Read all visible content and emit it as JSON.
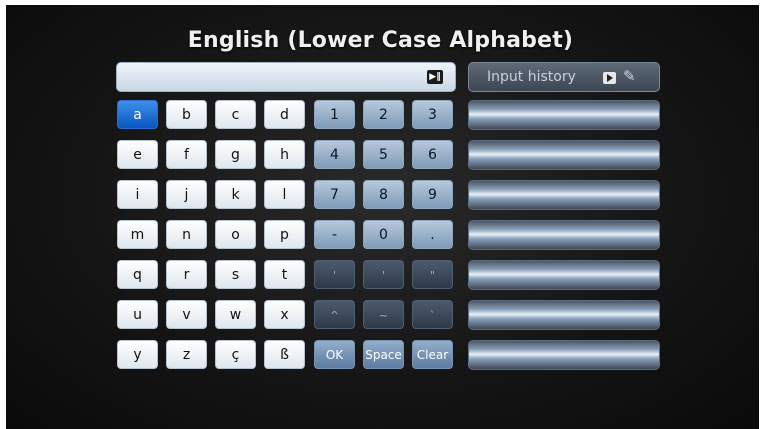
{
  "title": "English (Lower Case Alphabet)",
  "input": {
    "value": ""
  },
  "history": {
    "label": "Input history",
    "rows": [
      "",
      "",
      "",
      "",
      "",
      "",
      ""
    ]
  },
  "keys": {
    "row1": [
      "a",
      "b",
      "c",
      "d",
      "1",
      "2",
      "3"
    ],
    "row2": [
      "e",
      "f",
      "g",
      "h",
      "4",
      "5",
      "6"
    ],
    "row3": [
      "i",
      "j",
      "k",
      "l",
      "7",
      "8",
      "9"
    ],
    "row4": [
      "m",
      "n",
      "o",
      "p",
      "-",
      "0",
      "."
    ],
    "row5": [
      "q",
      "r",
      "s",
      "t",
      "'",
      "'",
      "\""
    ],
    "row6": [
      "u",
      "v",
      "w",
      "x",
      "^",
      "~",
      "`"
    ],
    "row7": [
      "y",
      "z",
      "ç",
      "ß",
      "OK",
      "Space",
      "Clear"
    ]
  },
  "colors": {
    "selected": "#0a55c0",
    "background": "#151515"
  }
}
